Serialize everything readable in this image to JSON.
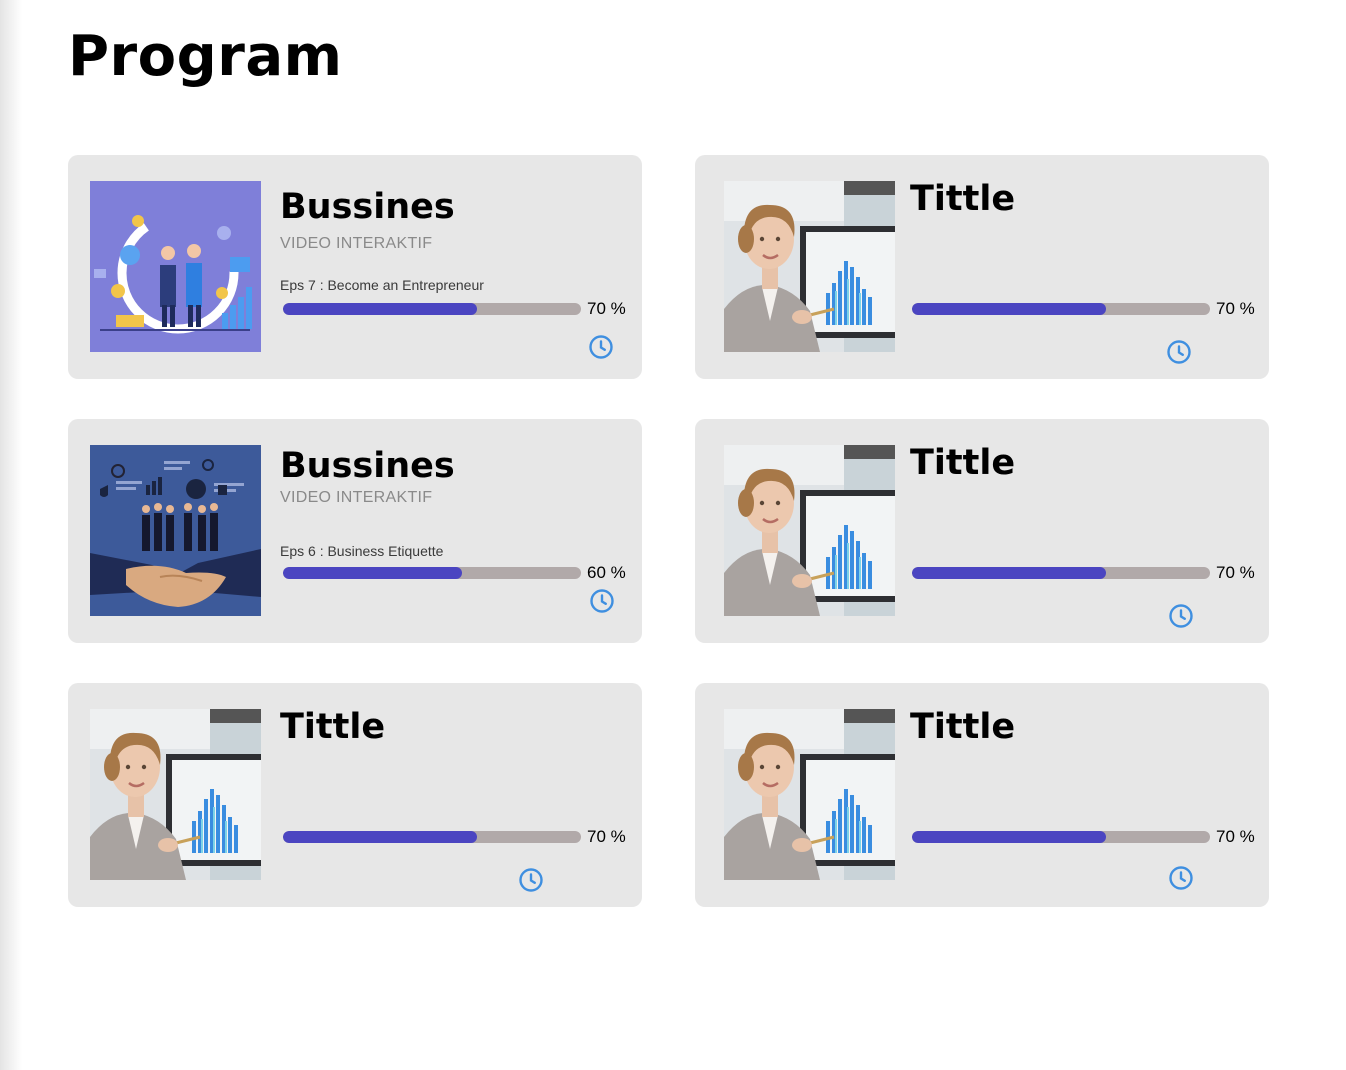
{
  "page": {
    "title": "Program"
  },
  "colors": {
    "card_bg": "#e7e7e7",
    "bar_fill": "#4b45c1",
    "bar_track": "#b1a9a9",
    "icon": "#3f8fe0"
  },
  "cards": [
    {
      "title": "Bussines",
      "subtitle": "VIDEO INTERAKTIF",
      "episode": "Eps 7 : Become an Entrepreneur",
      "progress": 0.65,
      "progress_label": "70 %",
      "icon": "clock-icon",
      "thumbnail": "handshake-illustration"
    },
    {
      "title": "Tittle",
      "subtitle": "",
      "episode": "",
      "progress": 0.65,
      "progress_label": "70 %",
      "icon": "clock-icon",
      "thumbnail": "woman-presenting-chart"
    },
    {
      "title": "Bussines",
      "subtitle": "VIDEO INTERAKTIF",
      "episode": "Eps 6 : Business Etiquette",
      "progress": 0.6,
      "progress_label": "60 %",
      "icon": "clock-icon",
      "thumbnail": "team-handshake-illustration"
    },
    {
      "title": "Tittle",
      "subtitle": "",
      "episode": "",
      "progress": 0.65,
      "progress_label": "70 %",
      "icon": "clock-icon",
      "thumbnail": "woman-presenting-chart"
    },
    {
      "title": "Tittle",
      "subtitle": "",
      "episode": "",
      "progress": 0.65,
      "progress_label": "70 %",
      "icon": "clock-icon",
      "thumbnail": "woman-presenting-chart"
    },
    {
      "title": "Tittle",
      "subtitle": "",
      "episode": "",
      "progress": 0.65,
      "progress_label": "70 %",
      "icon": "clock-icon",
      "thumbnail": "woman-presenting-chart"
    }
  ]
}
